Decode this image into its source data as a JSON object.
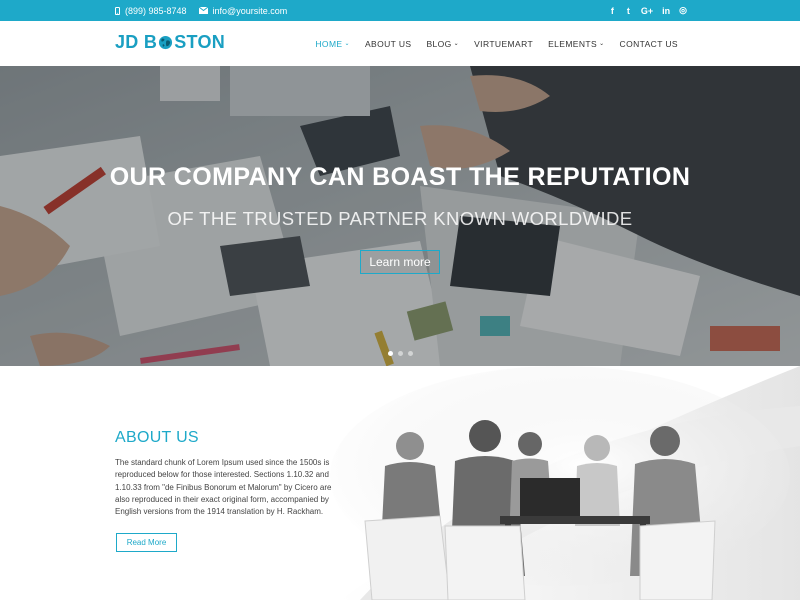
{
  "topbar": {
    "phone": "(899) 985-8748",
    "email": "info@yoursite.com",
    "socials": [
      {
        "icon": "facebook-icon",
        "glyph": "f"
      },
      {
        "icon": "twitter-icon",
        "glyph": "t"
      },
      {
        "icon": "google-plus-icon",
        "glyph": "G+"
      },
      {
        "icon": "linkedin-icon",
        "glyph": "in"
      },
      {
        "icon": "dribbble-icon",
        "glyph": "◎"
      }
    ]
  },
  "header": {
    "logo_left": "JD B",
    "logo_right": "STON",
    "nav": [
      {
        "label": "HOME",
        "caret": "⌄",
        "active": true
      },
      {
        "label": "ABOUT US",
        "caret": ""
      },
      {
        "label": "BLOG",
        "caret": "⌄"
      },
      {
        "label": "VIRTUEMART",
        "caret": ""
      },
      {
        "label": "ELEMENTS",
        "caret": "⌄"
      },
      {
        "label": "CONTACT US",
        "caret": ""
      }
    ]
  },
  "hero": {
    "title": "OUR COMPANY CAN BOAST THE REPUTATION",
    "subtitle": "OF THE TRUSTED PARTNER KNOWN WORLDWIDE",
    "button": "Learn more",
    "slides": 3,
    "active_slide": 0
  },
  "about": {
    "title": "ABOUT US",
    "text": "The standard chunk of Lorem Ipsum used since the 1500s is reproduced below for those interested. Sections 1.10.32 and 1.10.33 from \"de Finibus Bonorum et Malorum\" by Cicero are also reproduced in their exact original form, accompanied by English versions from the 1914 translation by H. Rackham.",
    "button": "Read More"
  },
  "colors": {
    "accent": "#1ea9c9",
    "topbar": "#1ea9c9",
    "nav_text": "#333333"
  }
}
